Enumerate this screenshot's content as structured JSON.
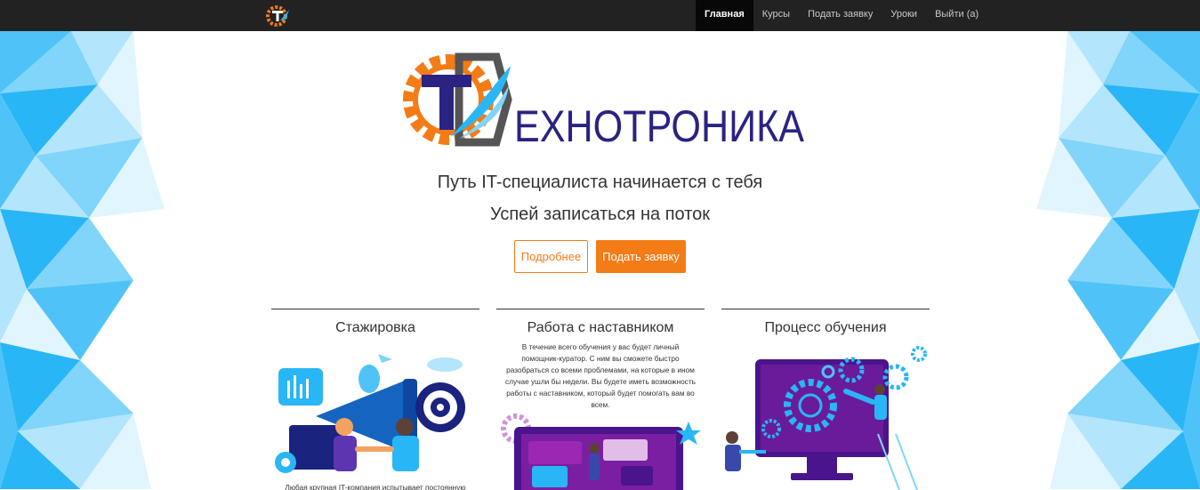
{
  "nav": {
    "items": [
      {
        "label": "Главная"
      },
      {
        "label": "Курсы"
      },
      {
        "label": "Подать заявку"
      },
      {
        "label": "Уроки"
      },
      {
        "label": "Выйти (a)"
      }
    ]
  },
  "logo": {
    "text": "ЕХНОТРОНИКА",
    "letter": "T"
  },
  "hero": {
    "tagline1": "Путь IT-специалиста начинается с тебя",
    "tagline2": "Успей записаться на поток",
    "btn_more": "Подробнее",
    "btn_apply": "Подать заявку"
  },
  "cards": [
    {
      "title": "Стажировка",
      "text": "Любая крупная IT-компания испытывает постоянную"
    },
    {
      "title": "Работа с наставником",
      "text": "В течение всего обучения у вас будет личный помощник-куратор. С ним вы сможете быстро разобраться со всеми проблемами, на которые в ином случае ушли бы недели. Вы будете иметь возможность работы с наставником, который будет помогать вам во всем."
    },
    {
      "title": "Процесс обучения",
      "text": ""
    }
  ],
  "colors": {
    "accent": "#f47c16",
    "navbar": "#222222",
    "brand_blue": "#2b2382",
    "bg_tri": "#29b6f6"
  }
}
